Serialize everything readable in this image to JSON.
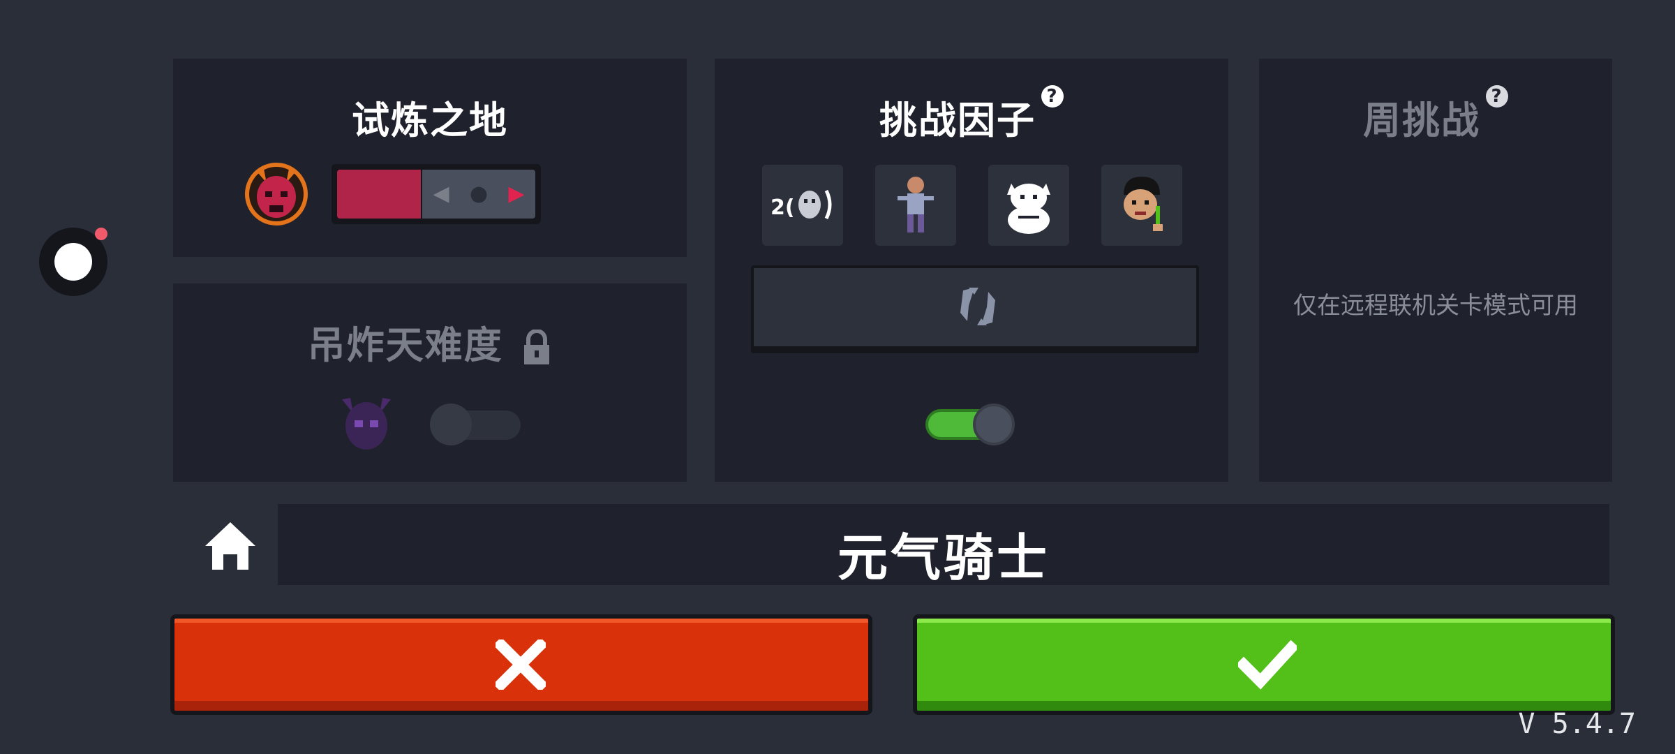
{
  "trial": {
    "title": "试炼之地"
  },
  "badass": {
    "title": "吊炸天难度"
  },
  "factors": {
    "title": "挑战因子",
    "help": "?",
    "items": [
      "2(",
      "",
      "",
      ""
    ]
  },
  "weekly": {
    "title": "周挑战",
    "help": "?",
    "notice": "仅在远程联机关卡模式可用"
  },
  "game_name": "元气骑士",
  "version": "V 5.4.7",
  "colors": {
    "cancel": "#d9320a",
    "confirm": "#52c018",
    "trial_fill": "#b1244a",
    "toggle_on": "#4fb93a"
  }
}
